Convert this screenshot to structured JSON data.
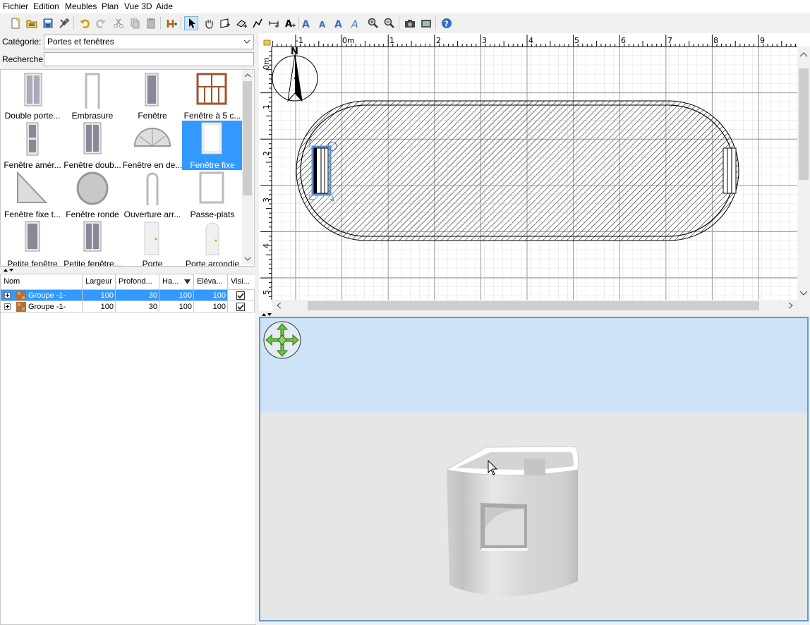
{
  "menu": [
    "Fichier",
    "Edition",
    "Meubles",
    "Plan",
    "Vue 3D",
    "Aide"
  ],
  "catalog": {
    "category_label": "Catégorie:",
    "category_value": "Portes et fenêtres",
    "search_label": "Recherche:",
    "search_value": "",
    "items": [
      {
        "name": "Double porte...",
        "icon": "double-door-icon"
      },
      {
        "name": "Embrasure",
        "icon": "door-frame-icon"
      },
      {
        "name": "Fenêtre",
        "icon": "window-icon"
      },
      {
        "name": "Fenêtre à 5 c...",
        "icon": "five-pane-window-icon"
      },
      {
        "name": "Fenêtre amér...",
        "icon": "american-window-icon"
      },
      {
        "name": "Fenêtre doub...",
        "icon": "double-window-icon"
      },
      {
        "name": "Fenêtre en de...",
        "icon": "half-round-window-icon"
      },
      {
        "name": "Fenêtre fixe",
        "icon": "fixed-window-icon",
        "selected": true
      },
      {
        "name": "Fenêtre fixe t...",
        "icon": "triangle-window-icon"
      },
      {
        "name": "Fenêtre ronde",
        "icon": "round-window-icon"
      },
      {
        "name": "Ouverture arr...",
        "icon": "arched-opening-icon"
      },
      {
        "name": "Passe-plats",
        "icon": "serving-hatch-icon"
      },
      {
        "name": "Petite fenêtre",
        "icon": "small-window-icon"
      },
      {
        "name": "Petite fenêtre...",
        "icon": "small-double-window-icon"
      },
      {
        "name": "Porte",
        "icon": "door-icon"
      },
      {
        "name": "Porte arrondie",
        "icon": "rounded-door-icon"
      }
    ]
  },
  "furniture_table": {
    "columns": [
      "Nom",
      "Largeur",
      "Profond...",
      "Ha...",
      "Eléva...",
      "Visi..."
    ],
    "rows": [
      {
        "name": "Groupe -1-",
        "width": "100",
        "depth": "30",
        "height": "100",
        "elevation": "100",
        "visible": true,
        "selected": true
      },
      {
        "name": "Groupe -1-",
        "width": "100",
        "depth": "30",
        "height": "100",
        "elevation": "100",
        "visible": true,
        "selected": false
      }
    ]
  },
  "plan": {
    "ruler_x": [
      "-1",
      "0m",
      "1",
      "2",
      "3",
      "4",
      "5",
      "6",
      "7",
      "8",
      "9"
    ],
    "ruler_y": [
      "0m",
      "1",
      "2",
      "3",
      "4",
      "5"
    ],
    "compass_label": "N"
  }
}
